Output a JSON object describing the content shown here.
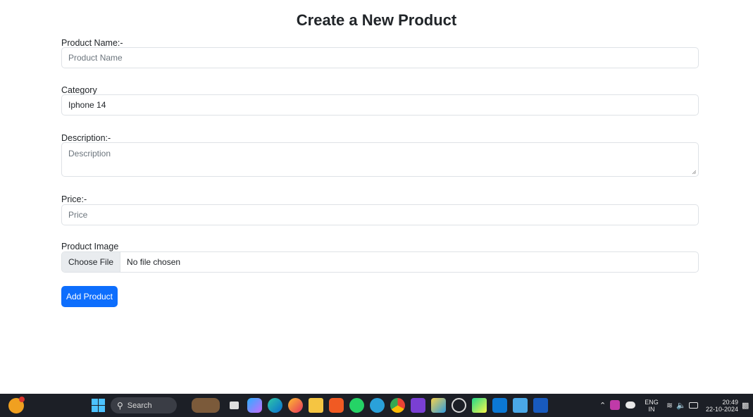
{
  "page": {
    "title": "Create a New Product"
  },
  "form": {
    "name_label": "Product Name:-",
    "name_placeholder": "Product Name",
    "category_label": "Category",
    "category_value": "Iphone 14",
    "description_label": "Description:-",
    "description_placeholder": "Description",
    "price_label": "Price:-",
    "price_placeholder": "Price",
    "image_label": "Product Image",
    "file_button_label": "Choose File",
    "file_status": "No file chosen",
    "submit_label": "Add Product",
    "accent_color": "#0d6efd"
  },
  "taskbar": {
    "search_label": "Search",
    "language": "ENG",
    "region": "IN",
    "time": "20:49",
    "date": "22-10-2024",
    "pinned_apps": [
      "widgets-icon",
      "start-icon",
      "search-icon",
      "game-icon",
      "file-explorer-icon",
      "copilot-icon",
      "edge-icon",
      "firefox-icon",
      "folder-icon",
      "brave-icon",
      "whatsapp-icon",
      "telegram-icon",
      "chrome-icon",
      "visual-studio-icon",
      "paint-icon",
      "circle-app-icon",
      "pycharm-icon",
      "vscode-icon",
      "notepad-icon",
      "word-icon"
    ]
  }
}
